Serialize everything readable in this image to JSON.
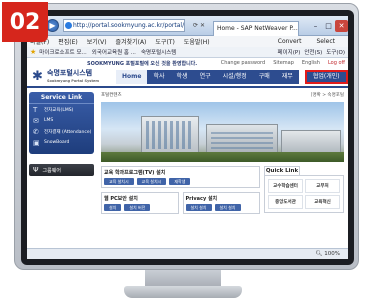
{
  "step": {
    "number": "02",
    "color": "#d6261c"
  },
  "browser": {
    "address": "http://portal.sookmyung.ac.kr/portal/",
    "tab_title": "Home - SAP NetWeaver P...",
    "menu": [
      "파일(F)",
      "편집(E)",
      "보기(V)",
      "즐겨찾기(A)",
      "도구(T)",
      "도움말(H)"
    ],
    "menu_right": [
      "Convert",
      "Select"
    ],
    "favorites": [
      "마이크로소프트 모...",
      "외국어교육원 홈 ...",
      "숙명포털시스템"
    ],
    "fav_tools": [
      "페이지(P)",
      "안전(S)",
      "도구(O)"
    ],
    "zoom": "100%",
    "highlight_color": "#e11b1b"
  },
  "portal": {
    "slogan": "SOOKMYUNG 포털포털에 오신 것을 환영합니다.",
    "top_links": [
      "Change password",
      "Sitemap",
      "English"
    ],
    "logout": "Log off",
    "logo_title": "숙명포털시스템",
    "logo_sub": "Sookmyung Portal System",
    "gnb": [
      "Home",
      "학사",
      "학생",
      "연구",
      "시설/행정",
      "구매",
      "재무"
    ],
    "gnb_highlight": "협업(개인)",
    "breadcrumb": "포털컨텐츠",
    "breadcrumb_right": "[명확 > 숙명포털",
    "service_link": {
      "title": "Service Link",
      "items": [
        {
          "icon": "T",
          "label": "전자교육(LMS)"
        },
        {
          "icon": "✉",
          "label": "LMS"
        },
        {
          "icon": "✆",
          "label": "전자결재 (Attendance)"
        },
        {
          "icon": "▣",
          "label": "SnowBoard"
        }
      ]
    },
    "group_label": "그룹웨어",
    "sections": [
      {
        "title": "교육 학과프로그램(TV) 설치",
        "buttons": [
          "교육 설치시",
          "교육 설치시",
          "재학생"
        ]
      },
      {
        "title": "웹 PC보안 설치",
        "buttons": [
          "설치",
          "설치 버전"
        ]
      },
      {
        "title": "Privacy 설치",
        "buttons": [
          "설치 설치",
          "설치 설치"
        ]
      }
    ],
    "quick_link": {
      "title": "Quick Link",
      "items": [
        "교수학습센터",
        "교무처",
        "중앙도서관",
        "교육혁신"
      ]
    }
  }
}
